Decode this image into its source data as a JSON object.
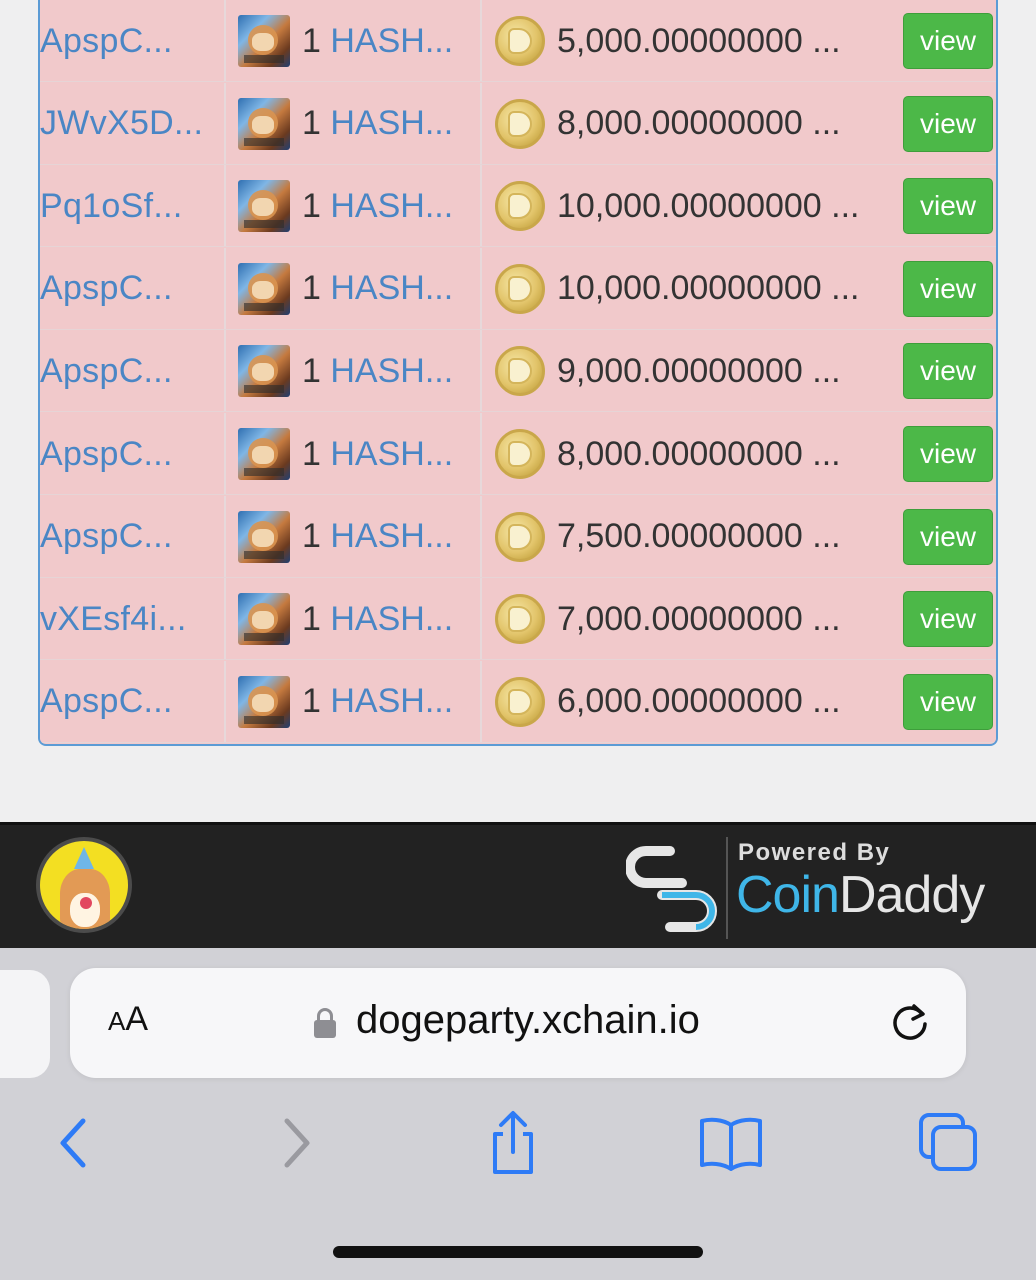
{
  "orders": [
    {
      "address": "ApspC...",
      "asset_qty": "1",
      "asset_name": "HASH...",
      "amount": "5,000.00000000 ...",
      "action": "view"
    },
    {
      "address": "JWvX5D...",
      "asset_qty": "1",
      "asset_name": "HASH...",
      "amount": "8,000.00000000 ...",
      "action": "view"
    },
    {
      "address": "Pq1oSf...",
      "asset_qty": "1",
      "asset_name": "HASH...",
      "amount": "10,000.00000000 ...",
      "action": "view"
    },
    {
      "address": "ApspC...",
      "asset_qty": "1",
      "asset_name": "HASH...",
      "amount": "10,000.00000000 ...",
      "action": "view"
    },
    {
      "address": "ApspC...",
      "asset_qty": "1",
      "asset_name": "HASH...",
      "amount": "9,000.00000000 ...",
      "action": "view"
    },
    {
      "address": "ApspC...",
      "asset_qty": "1",
      "asset_name": "HASH...",
      "amount": "8,000.00000000 ...",
      "action": "view"
    },
    {
      "address": "ApspC...",
      "asset_qty": "1",
      "asset_name": "HASH...",
      "amount": "7,500.00000000 ...",
      "action": "view"
    },
    {
      "address": "vXEsf4i...",
      "asset_qty": "1",
      "asset_name": "HASH...",
      "amount": "7,000.00000000 ...",
      "action": "view"
    },
    {
      "address": "ApspC...",
      "asset_qty": "1",
      "asset_name": "HASH...",
      "amount": "6,000.00000000 ...",
      "action": "view"
    }
  ],
  "footer": {
    "powered_by": "Powered By",
    "brand_coin": "Coin",
    "brand_daddy": "Daddy"
  },
  "browser": {
    "text_size_label_small": "A",
    "text_size_label_large": "A",
    "url": "dogeparty.xchain.io"
  },
  "icons": {
    "asset_thumb": "hash-asset-thumbnail-icon",
    "coin": "dogecoin-icon",
    "lock": "lock-icon",
    "reload": "reload-icon",
    "back": "back-chevron-icon",
    "forward": "forward-chevron-icon",
    "share": "share-icon",
    "bookmarks": "book-icon",
    "tabs": "tabs-icon"
  },
  "colors": {
    "row_background": "#f1c9cb",
    "link": "#4a86c5",
    "view_button": "#4cb848",
    "safari_blue": "#2e7bf6",
    "brand_blue": "#3fb6e8"
  }
}
